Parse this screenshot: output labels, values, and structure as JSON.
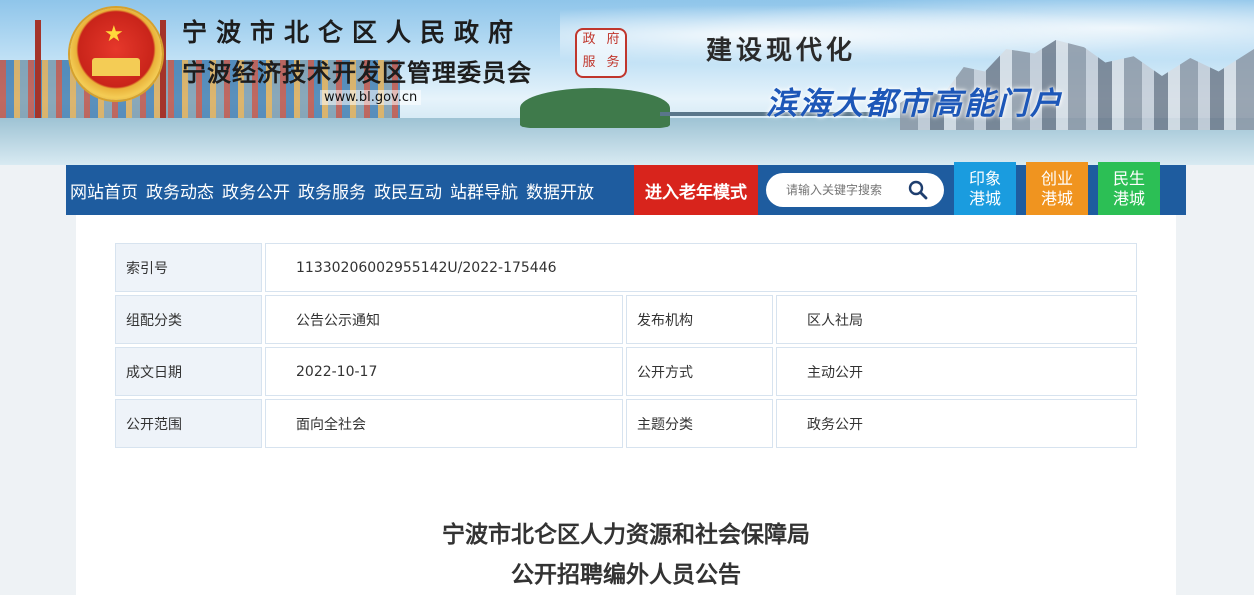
{
  "header": {
    "org_line1": "宁波市北仑区人民政府",
    "org_line2": "宁波经济技术开发区管理委员会",
    "site_url": "www.bl.gov.cn",
    "seal_chars": [
      "政",
      "府",
      "服",
      "务"
    ],
    "slogan_main": "建设现代化",
    "slogan_sub": "滨海大都市高能门户"
  },
  "nav": {
    "items": [
      "网站首页",
      "政务动态",
      "政务公开",
      "政务服务",
      "政民互动",
      "站群导航",
      "数据开放"
    ],
    "elder_mode": "进入老年模式",
    "search_placeholder": "请输入关键字搜索",
    "quick_links": [
      {
        "line1": "印象",
        "line2": "港城",
        "color": "#1a9cdf"
      },
      {
        "line1": "创业",
        "line2": "港城",
        "color": "#f0941f"
      },
      {
        "line1": "民生",
        "line2": "港城",
        "color": "#2cbf55"
      }
    ]
  },
  "meta": {
    "index_label": "索引号",
    "index_value": "11330206002955142U/2022-175446",
    "category_label": "组配分类",
    "category_value": "公告公示通知",
    "publisher_label": "发布机构",
    "publisher_value": "区人社局",
    "date_label": "成文日期",
    "date_value": "2022-10-17",
    "method_label": "公开方式",
    "method_value": "主动公开",
    "scope_label": "公开范围",
    "scope_value": "面向全社会",
    "topic_label": "主题分类",
    "topic_value": "政务公开"
  },
  "article": {
    "title_line1": "宁波市北仑区人力资源和社会保障局",
    "title_line2": "公开招聘编外人员公告"
  }
}
